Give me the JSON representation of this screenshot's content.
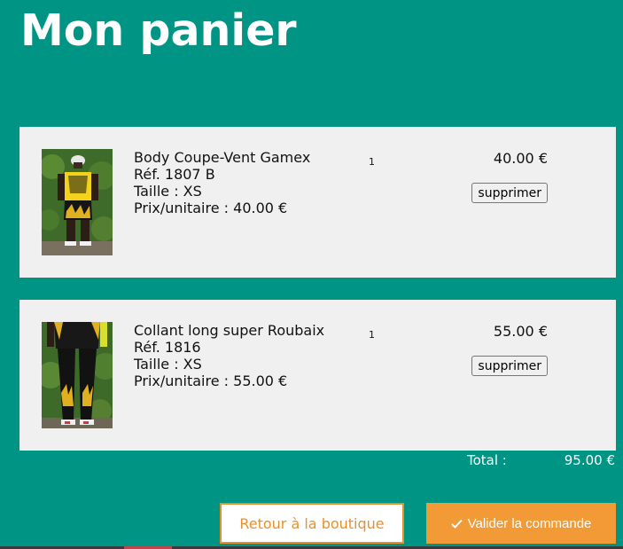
{
  "page": {
    "title": "Mon panier"
  },
  "cart": {
    "items": [
      {
        "name": "Body Coupe-Vent Gamex",
        "ref": "Réf. 1807 B",
        "size": "Taille : XS",
        "unit_price": "Prix/unitaire : 40.00 €",
        "quantity": "1",
        "price": "40.00 €",
        "remove_label": "supprimer"
      },
      {
        "name": "Collant long super Roubaix",
        "ref": "Réf. 1816",
        "size": "Taille : XS",
        "unit_price": "Prix/unitaire : 55.00 €",
        "quantity": "1",
        "price": "55.00 €",
        "remove_label": "supprimer"
      }
    ],
    "total_label": "Total :",
    "total_value": "95.00 €"
  },
  "actions": {
    "back_label": "Retour à la boutique",
    "validate_label": "Valider la commande",
    "validate_icon": "check-icon"
  },
  "colors": {
    "background": "#009485",
    "card": "#f0f0f0",
    "accent_orange": "#f29a36",
    "back_border": "#e8902c"
  }
}
